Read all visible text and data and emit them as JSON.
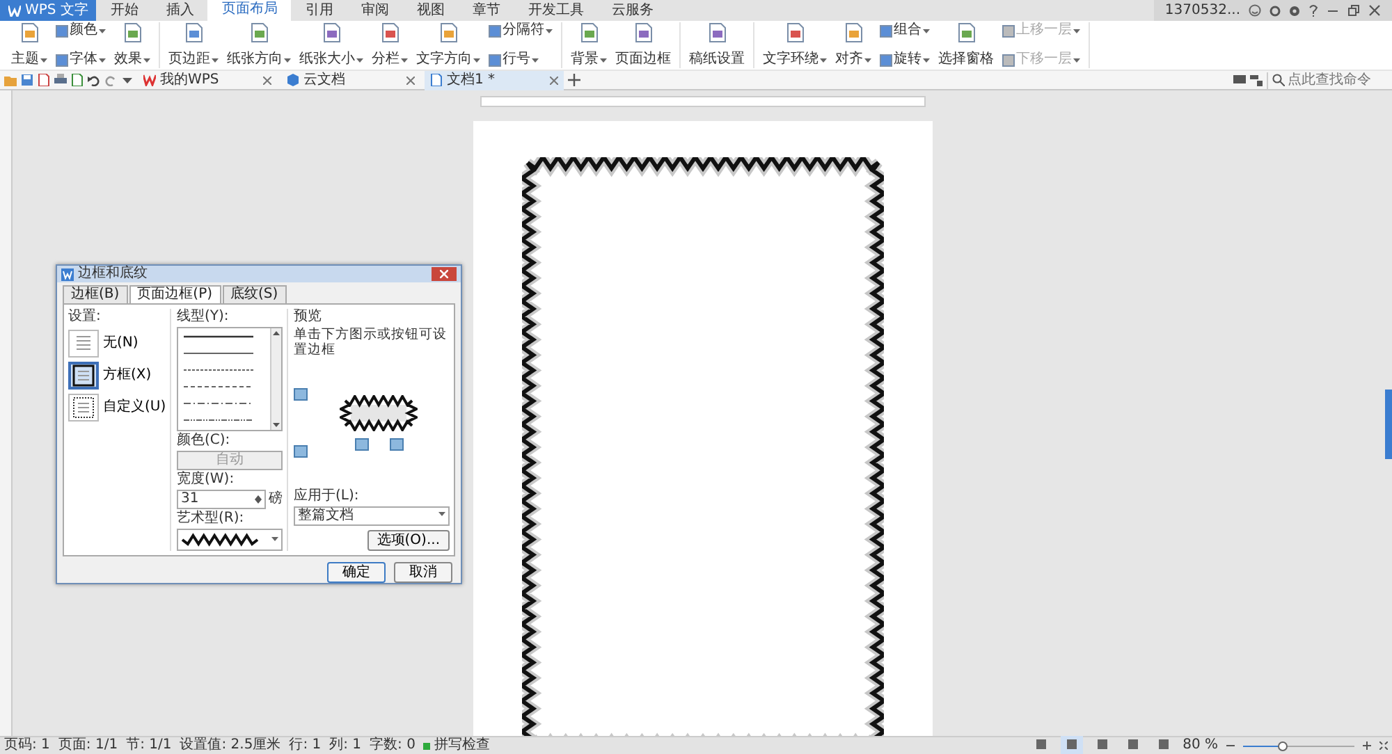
{
  "app": {
    "title": "WPS 文字"
  },
  "menu_tabs": [
    {
      "label": "开始",
      "selected": false
    },
    {
      "label": "插入",
      "selected": false
    },
    {
      "label": "页面布局",
      "selected": true
    },
    {
      "label": "引用",
      "selected": false
    },
    {
      "label": "审阅",
      "selected": false
    },
    {
      "label": "视图",
      "selected": false
    },
    {
      "label": "章节",
      "selected": false
    },
    {
      "label": "开发工具",
      "selected": false
    },
    {
      "label": "云服务",
      "selected": false
    }
  ],
  "account": {
    "name": "1370532..."
  },
  "ribbon_groups": [
    {
      "columns": [
        [
          {
            "label": "主题",
            "kind": "large",
            "dropdown": true,
            "disabled": false
          }
        ],
        [
          {
            "label": "颜色",
            "kind": "small",
            "dropdown": true,
            "disabled": false
          },
          {
            "label": "字体",
            "kind": "small",
            "dropdown": true,
            "disabled": false
          }
        ],
        [
          {
            "label": "效果",
            "kind": "large",
            "dropdown": true,
            "disabled": false
          }
        ]
      ]
    },
    {
      "columns": [
        [
          {
            "label": "页边距",
            "kind": "large",
            "dropdown": true,
            "disabled": false
          }
        ],
        [
          {
            "label": "纸张方向",
            "kind": "large",
            "dropdown": true,
            "disabled": false
          }
        ],
        [
          {
            "label": "纸张大小",
            "kind": "large",
            "dropdown": true,
            "disabled": false
          }
        ],
        [
          {
            "label": "分栏",
            "kind": "large",
            "dropdown": true,
            "disabled": false
          }
        ],
        [
          {
            "label": "文字方向",
            "kind": "large",
            "dropdown": true,
            "disabled": false
          }
        ],
        [
          {
            "label": "分隔符",
            "kind": "small",
            "dropdown": true,
            "disabled": false
          },
          {
            "label": "行号",
            "kind": "small",
            "dropdown": true,
            "disabled": false
          }
        ]
      ]
    },
    {
      "columns": [
        [
          {
            "label": "背景",
            "kind": "large",
            "dropdown": true,
            "disabled": false
          }
        ],
        [
          {
            "label": "页面边框",
            "kind": "large",
            "dropdown": false,
            "disabled": false
          }
        ]
      ]
    },
    {
      "columns": [
        [
          {
            "label": "稿纸设置",
            "kind": "large",
            "dropdown": false,
            "disabled": false
          }
        ]
      ]
    },
    {
      "columns": [
        [
          {
            "label": "文字环绕",
            "kind": "large",
            "dropdown": true,
            "disabled": false
          }
        ],
        [
          {
            "label": "对齐",
            "kind": "large",
            "dropdown": true,
            "disabled": false
          }
        ],
        [
          {
            "label": "组合",
            "kind": "small",
            "dropdown": true,
            "disabled": false
          },
          {
            "label": "旋转",
            "kind": "small",
            "dropdown": true,
            "disabled": false
          }
        ],
        [
          {
            "label": "选择窗格",
            "kind": "large",
            "dropdown": false,
            "disabled": false
          }
        ],
        [
          {
            "label": "上移一层",
            "kind": "small",
            "dropdown": true,
            "disabled": true
          },
          {
            "label": "下移一层",
            "kind": "small",
            "dropdown": true,
            "disabled": true
          }
        ]
      ]
    }
  ],
  "doc_tabs": [
    {
      "label": "我的WPS",
      "selected": false
    },
    {
      "label": "云文档",
      "selected": false
    },
    {
      "label": "文档1 *",
      "selected": true
    }
  ],
  "search": {
    "placeholder": "点此查找命令"
  },
  "dialog": {
    "title": "边框和底纹",
    "tabs": [
      {
        "label": "边框(B)",
        "selected": false
      },
      {
        "label": "页面边框(P)",
        "selected": true
      },
      {
        "label": "底纹(S)",
        "selected": false
      }
    ],
    "settings_label": "设置:",
    "settings": [
      {
        "label": "无(N)",
        "selected": false
      },
      {
        "label": "方框(X)",
        "selected": true
      },
      {
        "label": "自定义(U)",
        "selected": false
      }
    ],
    "line_style_label": "线型(Y):",
    "color_label": "颜色(C):",
    "color_value": "自动",
    "color_disabled": true,
    "width_label": "宽度(W):",
    "width_value": "31",
    "width_unit": "磅",
    "art_label": "艺术型(R):",
    "preview_label": "预览",
    "preview_hint": "单击下方图示或按钮可设置边框",
    "apply_label": "应用于(L):",
    "apply_value": "整篇文档",
    "options_button": "选项(O)...",
    "ok_button": "确定",
    "cancel_button": "取消"
  },
  "status_bar": {
    "items": [
      "页码: 1",
      "页面: 1/1",
      "节: 1/1",
      "设置值: 2.5厘米",
      "行: 1",
      "列: 1",
      "字数: 0"
    ],
    "spell_check": {
      "label": "拼写检查",
      "on": true
    },
    "view_modes": [
      {
        "selected": false
      },
      {
        "selected": true
      },
      {
        "selected": false
      },
      {
        "selected": false
      },
      {
        "selected": false
      }
    ],
    "zoom": {
      "reading": "80 %",
      "level": 0.35
    }
  }
}
